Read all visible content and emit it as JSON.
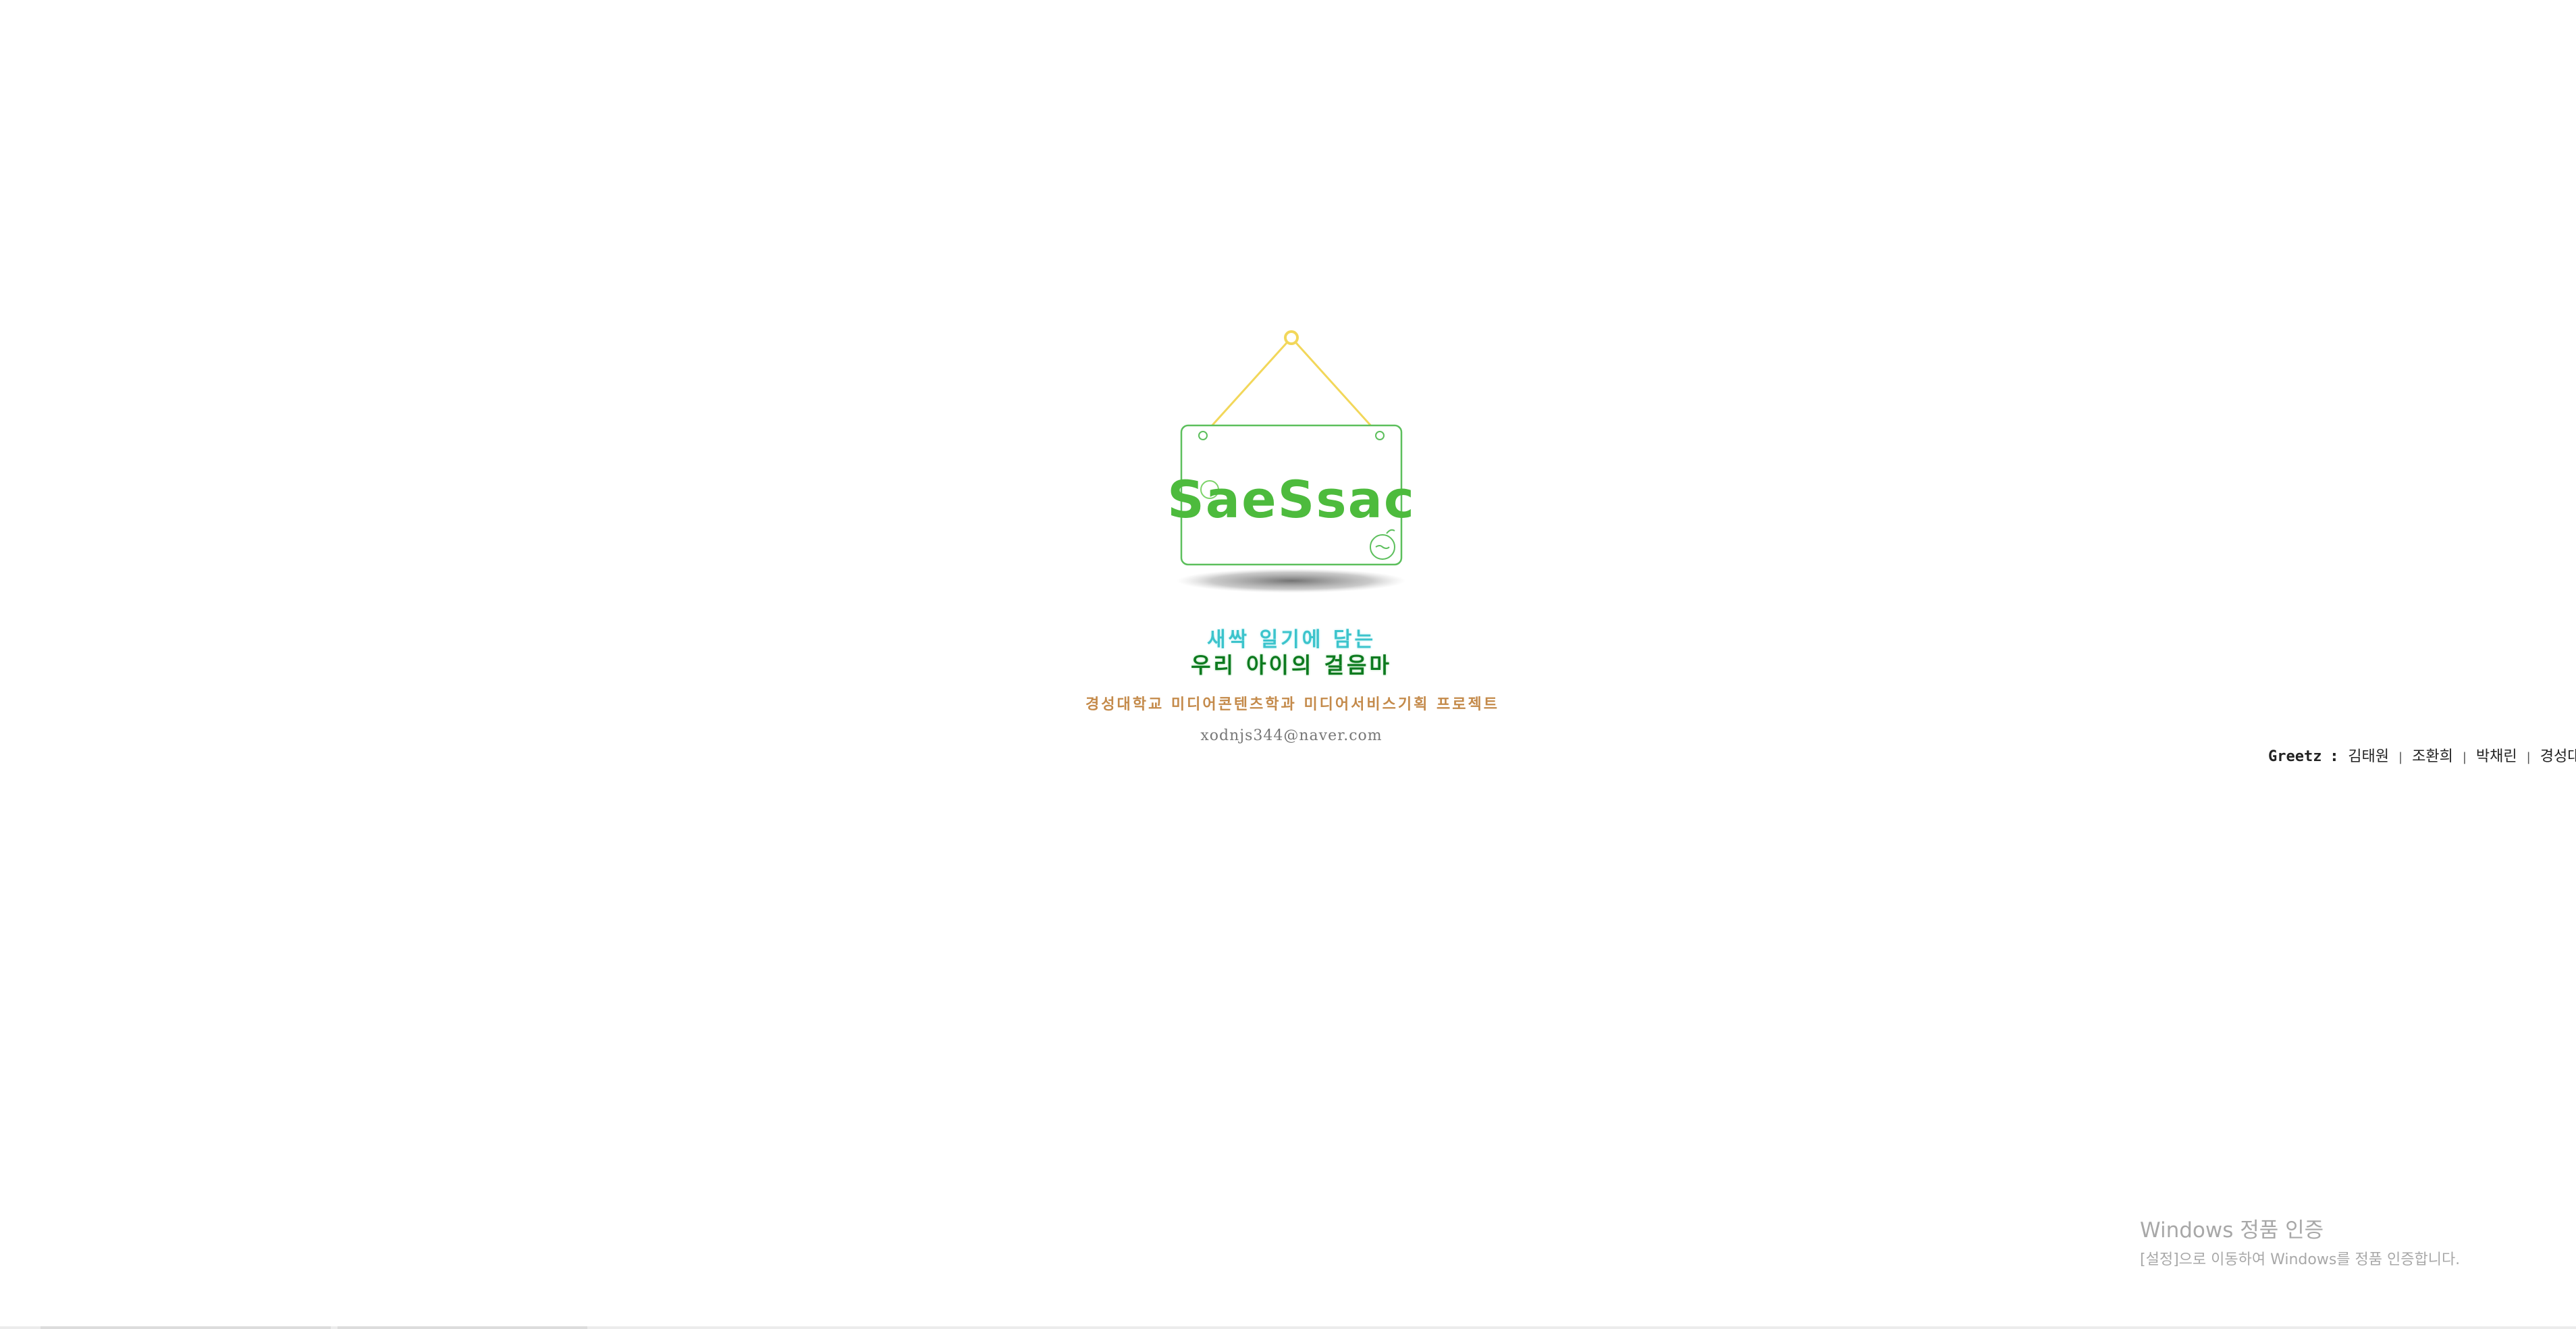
{
  "sign": {
    "logo_text": "SaeSsac"
  },
  "tagline": {
    "line1": "새싹 일기에 담는",
    "line2": "우리 아이의 걸음마"
  },
  "project": {
    "text": "경성대학교 미디어콘텐츠학과 미디어서비스기획 프로젝트"
  },
  "contact": {
    "email": "xodnjs344@naver.com"
  },
  "greetz": {
    "label": "Greetz",
    "colon": ":",
    "names": [
      "김태원",
      "조환희",
      "박채린",
      "경성대학교"
    ],
    "separator": "|"
  },
  "windows_activation": {
    "title": "Windows 정품 인증",
    "subtitle": "[설정]으로 이동하여 Windows를 정품 인증합니다."
  },
  "colors": {
    "sign_border": "#5cbf5c",
    "hanger_string": "#f2d75a",
    "logo_green": "#4dbb3d",
    "tagline_cyan": "#3cc4cc",
    "tagline_green": "#0d7a1f",
    "project_orange": "#c48a4a"
  }
}
